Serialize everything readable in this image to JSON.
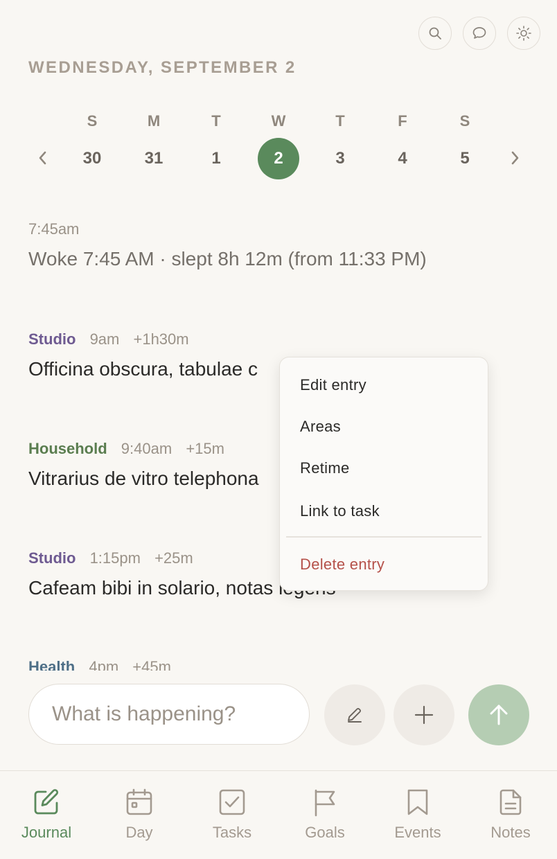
{
  "header": {
    "date_title": "WEDNESDAY, SEPTEMBER 2",
    "icons": [
      "search-icon",
      "chat-icon",
      "sun-icon"
    ]
  },
  "week": {
    "days": [
      {
        "dow": "S",
        "num": "30"
      },
      {
        "dow": "M",
        "num": "31"
      },
      {
        "dow": "T",
        "num": "1"
      },
      {
        "dow": "W",
        "num": "2"
      },
      {
        "dow": "T",
        "num": "3"
      },
      {
        "dow": "F",
        "num": "4"
      },
      {
        "dow": "S",
        "num": "5"
      }
    ],
    "selected_index": 3,
    "prev": "‹",
    "next": "›"
  },
  "entries": [
    {
      "area": "",
      "time": "7:45am",
      "duration": "",
      "text": "Woke 7:45 AM · slept 8h 12m (from 11:33 PM)"
    },
    {
      "area": "Studio",
      "area_color": "#6e5a91",
      "time": "9am",
      "duration": "+1h30m",
      "text": "Officina obscura, tabulae c"
    },
    {
      "area": "Household",
      "area_color": "#5a7d4f",
      "time": "9:40am",
      "duration": "+15m",
      "text": "Vitrarius de vitro telephona"
    },
    {
      "area": "Studio",
      "area_color": "#6e5a91",
      "time": "1:15pm",
      "duration": "+25m",
      "text": "Cafeam bibi in solario, notas legens"
    },
    {
      "area": "Health",
      "area_color": "#4e6f87",
      "time": "4pm",
      "duration": "+45m",
      "text": ""
    }
  ],
  "context_menu": {
    "edit": "Edit entry",
    "areas": "Areas",
    "retime": "Retime",
    "link": "Link to task",
    "delete": "Delete entry"
  },
  "composer": {
    "placeholder": "What is happening?"
  },
  "nav": {
    "items": [
      {
        "label": "Journal",
        "icon": "journal-edit-icon"
      },
      {
        "label": "Day",
        "icon": "calendar-icon"
      },
      {
        "label": "Tasks",
        "icon": "checkbox-icon"
      },
      {
        "label": "Goals",
        "icon": "flag-icon"
      },
      {
        "label": "Events",
        "icon": "bookmark-icon"
      },
      {
        "label": "Notes",
        "icon": "document-icon"
      }
    ],
    "active": "Journal"
  },
  "colors": {
    "accent": "#5a8a5c",
    "background": "#f9f7f3",
    "danger": "#b5514a",
    "studio": "#6e5a91",
    "household": "#5a7d4f",
    "health": "#4e6f87"
  }
}
